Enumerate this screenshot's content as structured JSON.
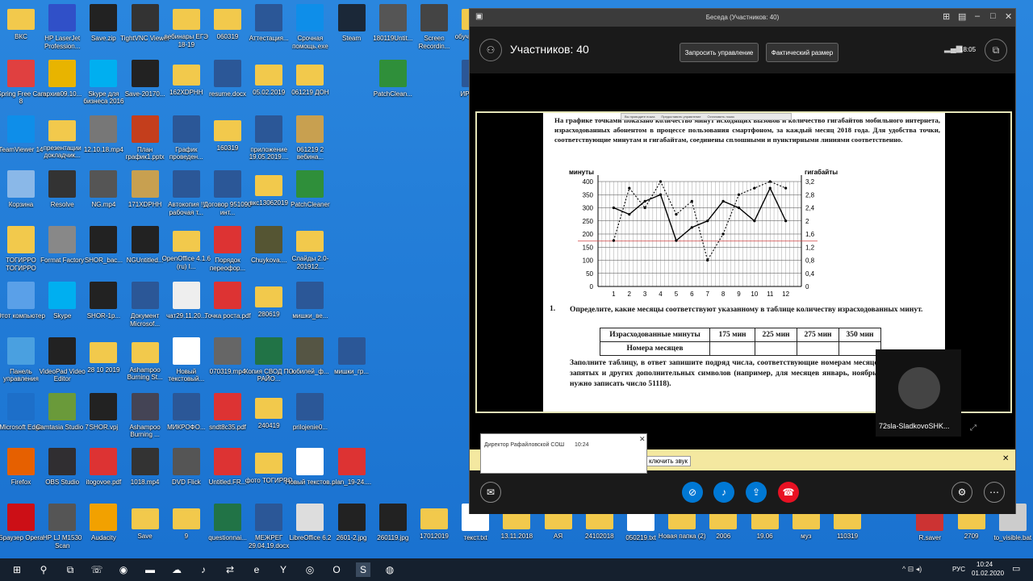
{
  "desktop_icons": [
    {
      "label": "ВКС",
      "icon": "folder-icon",
      "color": "#f2c94c",
      "col": 0,
      "row": 0
    },
    {
      "label": "HP LaserJet Profession...",
      "icon": "printer-icon",
      "color": "#3050c8",
      "col": 1,
      "row": 0
    },
    {
      "label": "Save.zip",
      "icon": "7z-icon",
      "color": "#222",
      "col": 2,
      "row": 0
    },
    {
      "label": "TightVNC Viewer",
      "icon": "vnc-icon",
      "color": "#333",
      "col": 3,
      "row": 0
    },
    {
      "label": "вебинары ЕГЭ 18-19",
      "icon": "folder-icon",
      "color": "#f2c94c",
      "col": 4,
      "row": 0
    },
    {
      "label": "060319",
      "icon": "folder-icon",
      "color": "#f2c94c",
      "col": 5,
      "row": 0
    },
    {
      "label": "Аттестация...",
      "icon": "word-icon",
      "color": "#2b5797",
      "col": 6,
      "row": 0
    },
    {
      "label": "Срочная помощь.exe",
      "icon": "teamviewer-icon",
      "color": "#0e8ee9",
      "col": 7,
      "row": 0
    },
    {
      "label": "Steam",
      "icon": "steam-icon",
      "color": "#1b2838",
      "col": 8,
      "row": 0
    },
    {
      "label": "180119Untit...",
      "icon": "video-icon",
      "color": "#555",
      "col": 9,
      "row": 0
    },
    {
      "label": "Screen Recordin...",
      "icon": "screen-icon",
      "color": "#444",
      "col": 10,
      "row": 0
    },
    {
      "label": "обуч органи...",
      "icon": "folder-icon",
      "color": "#f2c94c",
      "col": 11,
      "row": 0
    },
    {
      "label": "iSpring Free Cam 8",
      "icon": "ispring-icon",
      "color": "#e04040",
      "col": 0,
      "row": 1
    },
    {
      "label": "архив09.10...",
      "icon": "chrome-icon",
      "color": "#e8b400",
      "col": 1,
      "row": 1
    },
    {
      "label": "Skype для бизнеса 2016",
      "icon": "skype-icon",
      "color": "#00aff0",
      "col": 2,
      "row": 1
    },
    {
      "label": "Save-20170...",
      "icon": "7z-icon",
      "color": "#222",
      "col": 3,
      "row": 1
    },
    {
      "label": "162XDPHH",
      "icon": "folder-icon",
      "color": "#f2c94c",
      "col": 4,
      "row": 1
    },
    {
      "label": "resume.docx",
      "icon": "word-icon",
      "color": "#2b5797",
      "col": 5,
      "row": 1
    },
    {
      "label": "05.02.2019",
      "icon": "folder-icon",
      "color": "#f2c94c",
      "col": 6,
      "row": 1
    },
    {
      "label": "061219 ДОН",
      "icon": "folder-icon",
      "color": "#f2c94c",
      "col": 7,
      "row": 1
    },
    {
      "label": "PatchClean...",
      "icon": "patch-icon",
      "color": "#2f8f3a",
      "col": 9,
      "row": 1
    },
    {
      "label": "ИР РУС-Р",
      "icon": "word-icon",
      "color": "#2b5797",
      "col": 11,
      "row": 1
    },
    {
      "label": "TeamViewer 14",
      "icon": "teamviewer-icon",
      "color": "#0e8ee9",
      "col": 0,
      "row": 2
    },
    {
      "label": "презентации докладчик...",
      "icon": "folder-icon",
      "color": "#f2c94c",
      "col": 1,
      "row": 2
    },
    {
      "label": "12.10.18.mp4",
      "icon": "video-icon",
      "color": "#777",
      "col": 2,
      "row": 2
    },
    {
      "label": "План график1.pptx",
      "icon": "ppt-icon",
      "color": "#c43e1c",
      "col": 3,
      "row": 2
    },
    {
      "label": "График проведен...",
      "icon": "word-icon",
      "color": "#2b5797",
      "col": 4,
      "row": 2
    },
    {
      "label": "160319",
      "icon": "folder-icon",
      "color": "#f2c94c",
      "col": 5,
      "row": 2
    },
    {
      "label": "приложение 19.05.2019....",
      "icon": "word-icon",
      "color": "#2b5797",
      "col": 6,
      "row": 2
    },
    {
      "label": "061219 2 вебина...",
      "icon": "archive-icon",
      "color": "#c8a050",
      "col": 7,
      "row": 2
    },
    {
      "label": "Корзина",
      "icon": "recycle-bin-icon",
      "color": "#8ab8e8",
      "col": 0,
      "row": 3
    },
    {
      "label": "Resolve",
      "icon": "resolve-icon",
      "color": "#333",
      "col": 1,
      "row": 3
    },
    {
      "label": "NG.mp4",
      "icon": "video-icon",
      "color": "#555",
      "col": 2,
      "row": 3
    },
    {
      "label": "171XDPHH",
      "icon": "archive-icon",
      "color": "#c8a050",
      "col": 3,
      "row": 3
    },
    {
      "label": "Автокопия !! рабочая т...",
      "icon": "word-icon",
      "color": "#2b5797",
      "col": 4,
      "row": 3
    },
    {
      "label": "Договор 951090 инт...",
      "icon": "word-icon",
      "color": "#2b5797",
      "col": 5,
      "row": 3
    },
    {
      "label": "вкс13062019",
      "icon": "folder-icon",
      "color": "#f2c94c",
      "col": 6,
      "row": 3
    },
    {
      "label": "PatchCleaner",
      "icon": "recycle-icon",
      "color": "#2f8f3a",
      "col": 7,
      "row": 3
    },
    {
      "label": "ТОГИРРО ТОГИРРО",
      "icon": "user-folder-icon",
      "color": "#f2c94c",
      "col": 0,
      "row": 4
    },
    {
      "label": "Format Factory",
      "icon": "format-factory-icon",
      "color": "#888",
      "col": 1,
      "row": 4
    },
    {
      "label": "SHOR_bac...",
      "icon": "star-icon",
      "color": "#222",
      "col": 2,
      "row": 4
    },
    {
      "label": "NGUntitled...",
      "icon": "star-icon",
      "color": "#222",
      "col": 3,
      "row": 4
    },
    {
      "label": "OpenOffice 4.1.6 (ru) I...",
      "icon": "folder-icon",
      "color": "#f2c94c",
      "col": 4,
      "row": 4
    },
    {
      "label": "Порядок переофор...",
      "icon": "pdf-icon",
      "color": "#d33",
      "col": 5,
      "row": 4
    },
    {
      "label": "Chuykova....",
      "icon": "video-icon",
      "color": "#553",
      "col": 6,
      "row": 4
    },
    {
      "label": "Слайды 2.0-201912...",
      "icon": "folder-icon",
      "color": "#f2c94c",
      "col": 7,
      "row": 4
    },
    {
      "label": "Этот компьютер",
      "icon": "computer-icon",
      "color": "#5aa0e8",
      "col": 0,
      "row": 5
    },
    {
      "label": "Skype",
      "icon": "skype-icon",
      "color": "#00aff0",
      "col": 1,
      "row": 5
    },
    {
      "label": "SHOR-1p...",
      "icon": "star-icon",
      "color": "#222",
      "col": 2,
      "row": 5
    },
    {
      "label": "Документ Microsof...",
      "icon": "word-icon",
      "color": "#2b5797",
      "col": 3,
      "row": 5
    },
    {
      "label": "чат29.11.20...",
      "icon": "file-icon",
      "color": "#eee",
      "col": 4,
      "row": 5
    },
    {
      "label": "Точка роста.pdf",
      "icon": "pdf-icon",
      "color": "#d33",
      "col": 5,
      "row": 5
    },
    {
      "label": "280619",
      "icon": "folder-icon",
      "color": "#f2c94c",
      "col": 6,
      "row": 5
    },
    {
      "label": "мишки_ве...",
      "icon": "word-icon",
      "color": "#2b5797",
      "col": 7,
      "row": 5
    },
    {
      "label": "Панель управления",
      "icon": "control-panel-icon",
      "color": "#4aa0e0",
      "col": 0,
      "row": 6
    },
    {
      "label": "VideoPad Video Editor",
      "icon": "star-icon",
      "color": "#222",
      "col": 1,
      "row": 6
    },
    {
      "label": "28 10 2019",
      "icon": "folder-icon",
      "color": "#f2c94c",
      "col": 2,
      "row": 6
    },
    {
      "label": "Ashampoo Burning St...",
      "icon": "folder-icon",
      "color": "#f2c94c",
      "col": 3,
      "row": 6
    },
    {
      "label": "Новый текстовый...",
      "icon": "text-file-icon",
      "color": "#fff",
      "col": 4,
      "row": 6
    },
    {
      "label": "070319.mp4",
      "icon": "video-icon",
      "color": "#666",
      "col": 5,
      "row": 6
    },
    {
      "label": "Копия СВОД ПО РАЙО...",
      "icon": "excel-icon",
      "color": "#217346",
      "col": 6,
      "row": 6
    },
    {
      "label": "юбилей_ф...",
      "icon": "video-icon",
      "color": "#554",
      "col": 7,
      "row": 6
    },
    {
      "label": "мишки_гр...",
      "icon": "word-icon",
      "color": "#2b5797",
      "col": 8,
      "row": 6
    },
    {
      "label": "Microsoft Edge",
      "icon": "edge-icon",
      "color": "#1d6fc9",
      "col": 0,
      "row": 7
    },
    {
      "label": "Camtasia Studio 7",
      "icon": "camtasia-icon",
      "color": "#6a9a3a",
      "col": 1,
      "row": 7
    },
    {
      "label": "SHOR.vpj",
      "icon": "star-icon",
      "color": "#222",
      "col": 2,
      "row": 7
    },
    {
      "label": "Ashampoo Burning ...",
      "icon": "ashampoo-icon",
      "color": "#445",
      "col": 3,
      "row": 7
    },
    {
      "label": "МИКРОФО...",
      "icon": "word-icon",
      "color": "#2b5797",
      "col": 4,
      "row": 7
    },
    {
      "label": "sndt8c35.pdf",
      "icon": "pdf-icon",
      "color": "#d33",
      "col": 5,
      "row": 7
    },
    {
      "label": "240419",
      "icon": "folder-icon",
      "color": "#f2c94c",
      "col": 6,
      "row": 7
    },
    {
      "label": "prilojenie0...",
      "icon": "word-icon",
      "color": "#2b5797",
      "col": 7,
      "row": 7
    },
    {
      "label": "Firefox",
      "icon": "firefox-icon",
      "color": "#e66000",
      "col": 0,
      "row": 8
    },
    {
      "label": "OBS Studio",
      "icon": "obs-icon",
      "color": "#302e31",
      "col": 1,
      "row": 8
    },
    {
      "label": "itogovoe.pdf",
      "icon": "pdf-icon",
      "color": "#d33",
      "col": 2,
      "row": 8
    },
    {
      "label": "1018.mp4",
      "icon": "video-icon",
      "color": "#333",
      "col": 3,
      "row": 8
    },
    {
      "label": "DVD Flick",
      "icon": "dvd-icon",
      "color": "#555",
      "col": 4,
      "row": 8
    },
    {
      "label": "Untitled.FR...",
      "icon": "pdf-icon",
      "color": "#d33",
      "col": 5,
      "row": 8
    },
    {
      "label": "фото ТОГИРРО",
      "icon": "folder-icon",
      "color": "#f2c94c",
      "col": 6,
      "row": 8
    },
    {
      "label": "Новый текстов...",
      "icon": "text-file-icon",
      "color": "#fff",
      "col": 7,
      "row": 8
    },
    {
      "label": "plan_19-24....",
      "icon": "pdf-icon",
      "color": "#d33",
      "col": 8,
      "row": 8
    },
    {
      "label": "Браузер Opera",
      "icon": "opera-icon",
      "color": "#cc0f16",
      "col": 0,
      "row": 9
    },
    {
      "label": "HP LJ M1530 Scan",
      "icon": "scanner-icon",
      "color": "#555",
      "col": 1,
      "row": 9
    },
    {
      "label": "Audacity",
      "icon": "audacity-icon",
      "color": "#f2a100",
      "col": 2,
      "row": 9
    },
    {
      "label": "Save",
      "icon": "folder-icon",
      "color": "#f2c94c",
      "col": 3,
      "row": 9
    },
    {
      "label": "9",
      "icon": "folder-icon",
      "color": "#f2c94c",
      "col": 4,
      "row": 9
    },
    {
      "label": "questionnai...",
      "icon": "excel-icon",
      "color": "#217346",
      "col": 5,
      "row": 9
    },
    {
      "label": "МЕЖРЕГ 29.04.19.docx",
      "icon": "word-icon",
      "color": "#2b5797",
      "col": 6,
      "row": 9
    },
    {
      "label": "LibreOffice 6.2",
      "icon": "libreoffice-icon",
      "color": "#ddd",
      "col": 7,
      "row": 9
    },
    {
      "label": "2601-2.jpg",
      "icon": "image-icon",
      "color": "#222",
      "col": 8,
      "row": 9
    },
    {
      "label": "260119.jpg",
      "icon": "image-icon",
      "color": "#222",
      "col": 9,
      "row": 9
    },
    {
      "label": "17012019",
      "icon": "folder-icon",
      "color": "#f2c94c",
      "col": 10,
      "row": 9
    },
    {
      "label": "текст.txt",
      "icon": "text-file-icon",
      "color": "#fff",
      "col": 11,
      "row": 9
    },
    {
      "label": "13.11.2018",
      "icon": "folder-icon",
      "color": "#f2c94c",
      "col": 12,
      "row": 9
    },
    {
      "label": "АЯ",
      "icon": "folder-icon",
      "color": "#f2c94c",
      "col": 13,
      "row": 9
    },
    {
      "label": "24102018",
      "icon": "folder-icon",
      "color": "#f2c94c",
      "col": 14,
      "row": 9
    },
    {
      "label": "050219.txt",
      "icon": "text-file-icon",
      "color": "#fff",
      "col": 15,
      "row": 9
    },
    {
      "label": "Новая папка (2)",
      "icon": "folder-icon",
      "color": "#f2c94c",
      "col": 16,
      "row": 9
    },
    {
      "label": "2006",
      "icon": "folder-icon",
      "color": "#f2c94c",
      "col": 17,
      "row": 9
    },
    {
      "label": "19.06",
      "icon": "folder-icon",
      "color": "#f2c94c",
      "col": 18,
      "row": 9
    },
    {
      "label": "муз",
      "icon": "folder-icon",
      "color": "#f2c94c",
      "col": 19,
      "row": 9
    },
    {
      "label": "110319",
      "icon": "folder-icon",
      "color": "#f2c94c",
      "col": 20,
      "row": 9
    },
    {
      "label": "R.saver",
      "icon": "rsaver-icon",
      "color": "#c33",
      "col": 22,
      "row": 9
    },
    {
      "label": "2709",
      "icon": "folder-icon",
      "color": "#f2c94c",
      "col": 23,
      "row": 9
    },
    {
      "label": "to_visible.bat",
      "icon": "bat-icon",
      "color": "#ccc",
      "col": 24,
      "row": 9
    }
  ],
  "skype": {
    "window_title": "Беседа (Участников: 40)",
    "participants": "Участников: 40",
    "request_control": "Запросить управление",
    "actual_size": "Фактический размер",
    "time": "18:05",
    "camera_name": "72sla-SladkovoSHK...",
    "notice_text": "ключить звук",
    "toast_from": "Директор Рафайловской СОШ",
    "toast_time": "10:24",
    "mini_toolbar_a": "Вы проводите показ",
    "mini_toolbar_b": "Предоставить управление",
    "mini_toolbar_c": "Остановить показ"
  },
  "document": {
    "intro": "На графике точками показано количество минут исходящих вызовов и количество гигабайтов мобильного интернета, израсходованных абонентом в процессе пользования смартфоном, за каждый месяц 2018 года. Для удобства точки, соответствующие минутам и гигабайтам, соединены сплошными и пунктирными линиями соответственно.",
    "question_number": "1.",
    "question_text": "Определите, какие месяцы соответствуют указанному в таблице количеству израсходованных минут.",
    "table_header": [
      "Израсходованные минуты",
      "175 мин",
      "225 мин",
      "275 мин",
      "350 мин"
    ],
    "table_row_label": "Номера месяцев",
    "paragraph2": "Заполните таблицу, в ответ запишите подряд числа, соответствующие номерам месяцев, без пробелов, запятых и других дополнительных символов (например, для месяцев январь, ноябрь, август в ответ нужно записать число 51118)."
  },
  "chart_data": {
    "type": "line",
    "x": [
      1,
      2,
      3,
      4,
      5,
      6,
      7,
      8,
      9,
      10,
      11,
      12
    ],
    "ylabel": "минуты",
    "y2label": "гигабайты",
    "ylim": [
      0,
      400
    ],
    "y2lim": [
      0,
      3.2
    ],
    "yticks": [
      0,
      50,
      100,
      150,
      200,
      250,
      300,
      350,
      400
    ],
    "y2ticks": [
      "0",
      "0,4",
      "0,8",
      "1,2",
      "1,6",
      "2",
      "2,4",
      "2,8",
      "3,2"
    ],
    "series": [
      {
        "name": "минуты",
        "style": "solid",
        "values": [
          300,
          275,
          325,
          350,
          175,
          225,
          250,
          325,
          300,
          250,
          375,
          250
        ]
      },
      {
        "name": "гигабайты",
        "style": "dashed",
        "values": [
          1.4,
          3.0,
          2.4,
          3.2,
          2.2,
          2.6,
          0.8,
          1.6,
          2.8,
          3.0,
          3.2,
          3.0
        ]
      }
    ]
  },
  "taskbar": {
    "lang": "РУС",
    "time": "10:24",
    "date": "01.02.2020",
    "icons": [
      "start-icon",
      "search-icon",
      "task-view-icon",
      "viber-icon",
      "browser-icon",
      "folder-icon",
      "cloud-icon",
      "mic-icon",
      "teamviewer-icon",
      "edge-icon",
      "yandex-icon",
      "chrome-icon",
      "opera-icon",
      "skype-icon",
      "obs-icon"
    ]
  }
}
